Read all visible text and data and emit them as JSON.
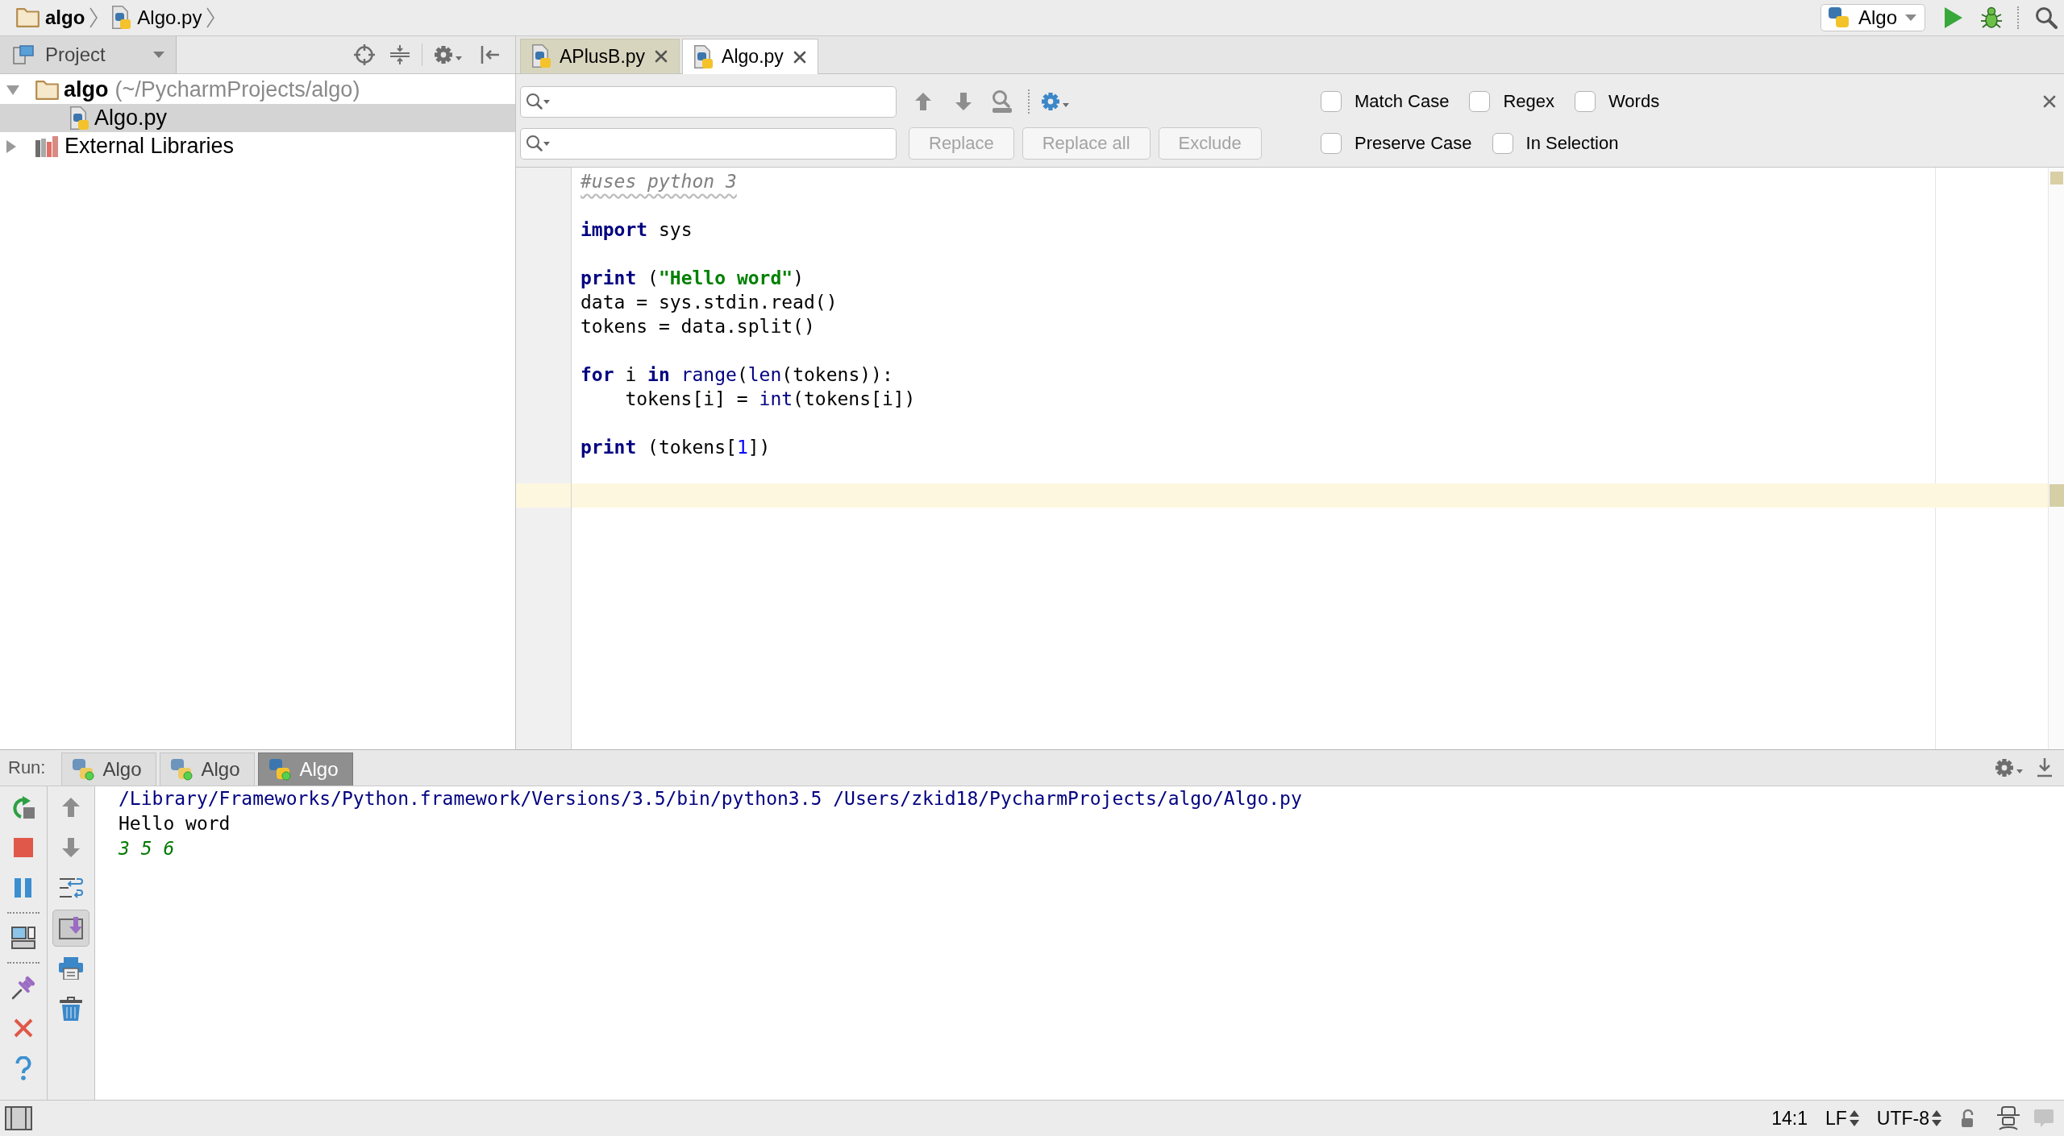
{
  "breadcrumbs": [
    {
      "label": "algo",
      "kind": "folder"
    },
    {
      "label": "Algo.py",
      "kind": "python-file"
    }
  ],
  "run_config": {
    "label": "Algo"
  },
  "project_panel": {
    "title": "Project"
  },
  "project_tree": [
    {
      "label": "algo",
      "path": "(~/PycharmProjects/algo)",
      "kind": "folder",
      "expanded": true,
      "selected": false,
      "children": [
        {
          "label": "Algo.py",
          "kind": "python-file",
          "selected": true
        }
      ]
    },
    {
      "label": "External Libraries",
      "kind": "library",
      "expanded": false,
      "selected": false
    }
  ],
  "editor_tabs": [
    {
      "label": "APlusB.py",
      "selected": false
    },
    {
      "label": "Algo.py",
      "selected": true
    }
  ],
  "find_bar": {
    "buttons": [
      {
        "label": "Replace",
        "disabled": true
      },
      {
        "label": "Replace all",
        "disabled": true
      },
      {
        "label": "Exclude",
        "disabled": true
      }
    ],
    "option_rows": [
      {
        "options": [
          {
            "label": "Match Case",
            "checked": false
          },
          {
            "label": "Regex",
            "checked": false
          },
          {
            "label": "Words",
            "checked": false
          }
        ]
      },
      {
        "options": [
          {
            "label": "Preserve Case",
            "checked": false
          },
          {
            "label": "In Selection",
            "checked": false
          }
        ]
      }
    ]
  },
  "code_lines": [
    {
      "kind": "code",
      "current": false,
      "tokens": [
        {
          "kind": "comment",
          "text": "#uses python 3"
        }
      ]
    },
    {
      "kind": "blank",
      "current": false
    },
    {
      "kind": "code",
      "current": false,
      "tokens": [
        {
          "kind": "keyword",
          "text": "import"
        },
        {
          "kind": "plain",
          "text": " sys"
        }
      ]
    },
    {
      "kind": "blank",
      "current": false
    },
    {
      "kind": "code",
      "current": false,
      "tokens": [
        {
          "kind": "keyword",
          "text": "print"
        },
        {
          "kind": "plain",
          "text": " ("
        },
        {
          "kind": "string",
          "text": "\"Hello word\""
        },
        {
          "kind": "plain",
          "text": ")"
        }
      ]
    },
    {
      "kind": "code",
      "current": false,
      "tokens": [
        {
          "kind": "plain",
          "text": "data = sys.stdin.read()"
        }
      ]
    },
    {
      "kind": "code",
      "current": false,
      "tokens": [
        {
          "kind": "plain",
          "text": "tokens = data.split()"
        }
      ]
    },
    {
      "kind": "blank",
      "current": false
    },
    {
      "kind": "code",
      "current": false,
      "tokens": [
        {
          "kind": "keyword",
          "text": "for"
        },
        {
          "kind": "plain",
          "text": " i "
        },
        {
          "kind": "keyword",
          "text": "in "
        },
        {
          "kind": "builtin",
          "text": "range"
        },
        {
          "kind": "plain",
          "text": "("
        },
        {
          "kind": "builtin",
          "text": "len"
        },
        {
          "kind": "plain",
          "text": "(tokens)):"
        }
      ]
    },
    {
      "kind": "code",
      "current": false,
      "tokens": [
        {
          "kind": "plain",
          "text": "    tokens[i] = "
        },
        {
          "kind": "builtin",
          "text": "int"
        },
        {
          "kind": "plain",
          "text": "(tokens[i])"
        }
      ]
    },
    {
      "kind": "blank",
      "current": false
    },
    {
      "kind": "code",
      "current": false,
      "tokens": [
        {
          "kind": "keyword",
          "text": "print"
        },
        {
          "kind": "plain",
          "text": " (tokens["
        },
        {
          "kind": "number",
          "text": "1"
        },
        {
          "kind": "plain",
          "text": "])"
        }
      ]
    },
    {
      "kind": "blank",
      "current": false
    },
    {
      "kind": "blank",
      "current": true
    }
  ],
  "run_panel": {
    "label": "Run:",
    "tabs": [
      {
        "label": "Algo",
        "selected": false
      },
      {
        "label": "Algo",
        "selected": false
      },
      {
        "label": "Algo",
        "selected": true
      }
    ],
    "scroll_to_end": {
      "pressed": true
    },
    "output": [
      {
        "kind": "command",
        "text": "/Library/Frameworks/Python.framework/Versions/3.5/bin/python3.5 /Users/zkid18/PycharmProjects/algo/Algo.py"
      },
      {
        "kind": "stdout",
        "text": "Hello word"
      },
      {
        "kind": "stdin",
        "text": "3 5 6"
      }
    ]
  },
  "status_bar": {
    "caret_position": "14:1",
    "line_separator": "LF",
    "encoding": "UTF-8"
  }
}
